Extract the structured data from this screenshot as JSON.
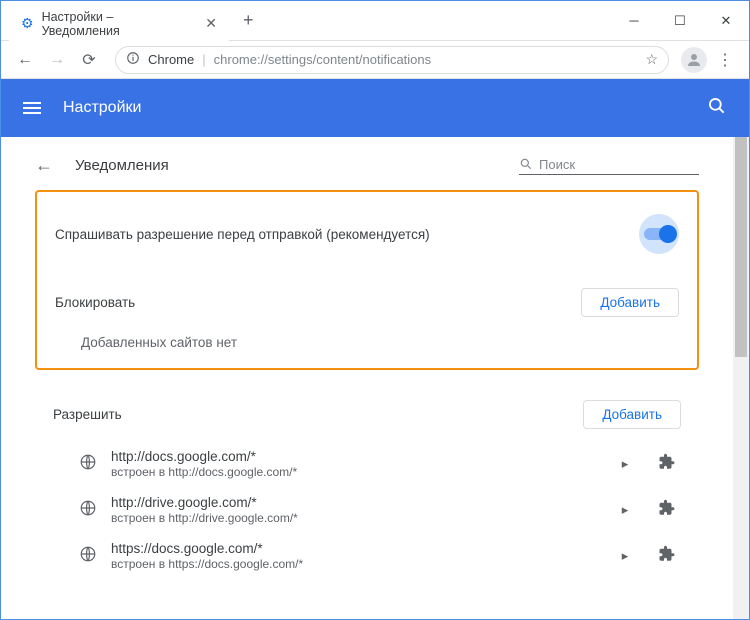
{
  "window": {
    "tab_title": "Настройки – Уведомления"
  },
  "omnibox": {
    "prefix": "Chrome",
    "path": "chrome://settings/content/notifications"
  },
  "blue_header": {
    "title": "Настройки"
  },
  "page": {
    "title": "Уведомления",
    "search_placeholder": "Поиск"
  },
  "ask_setting": {
    "label": "Спрашивать разрешение перед отправкой (рекомендуется)"
  },
  "block_section": {
    "title": "Блокировать",
    "add_label": "Добавить",
    "empty": "Добавленных сайтов нет"
  },
  "allow_section": {
    "title": "Разрешить",
    "add_label": "Добавить",
    "sites": [
      {
        "url": "http://docs.google.com/*",
        "sub": "встроен в http://docs.google.com/*"
      },
      {
        "url": "http://drive.google.com/*",
        "sub": "встроен в http://drive.google.com/*"
      },
      {
        "url": "https://docs.google.com/*",
        "sub": "встроен в https://docs.google.com/*"
      }
    ]
  }
}
